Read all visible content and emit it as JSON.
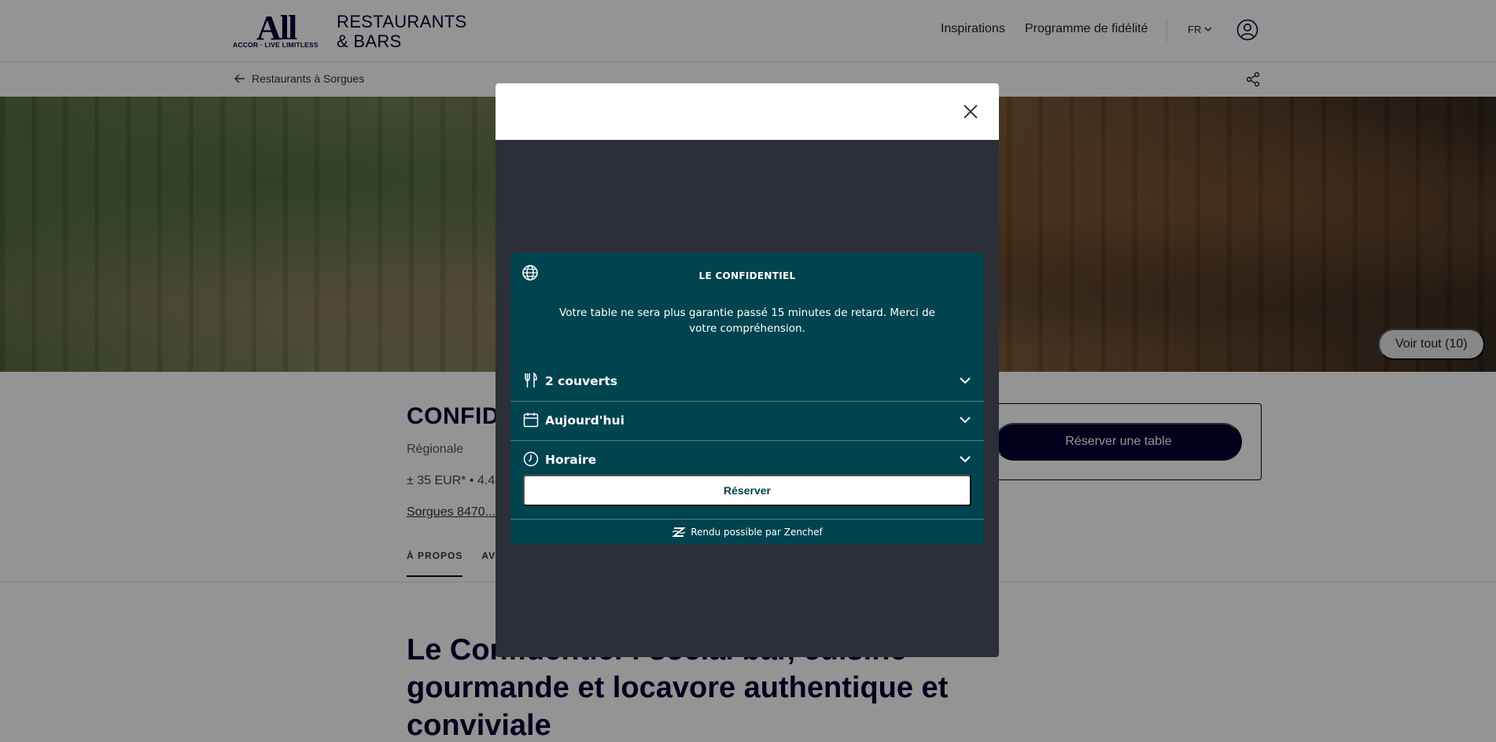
{
  "header": {
    "logo_text": "All",
    "logo_tagline": "ACCOR · LIVE LIMITLESS",
    "brand_line1": "RESTAURANTS",
    "brand_line2": "& BARS",
    "nav_inspirations": "Inspirations",
    "nav_fidelite": "Programme de fidélité",
    "language": "FR"
  },
  "subnav": {
    "back_label": "Restaurants à Sorgues"
  },
  "hero": {
    "see_all_label": "Voir tout (10)"
  },
  "restaurant": {
    "name": "CONFID",
    "category": "Régionale",
    "price_rating": "± 35 EUR*  •  4.4",
    "address": "Sorgues 8470...",
    "tabs": [
      "À PROPOS",
      "AVI"
    ],
    "book_label": "Réserver une table",
    "headline": "Le Confidentiel : social bar, cuisine gourmande et locavore authentique et conviviale"
  },
  "modal": {
    "widget": {
      "title": "LE CONFIDENTIEL",
      "notice": "Votre table ne sera plus garantie passé 15 minutes de retard. Merci de votre compréhension.",
      "rows": [
        {
          "label": "2 couverts",
          "icon": "cutlery-icon"
        },
        {
          "label": "Aujourd'hui",
          "icon": "calendar-icon"
        },
        {
          "label": "Horaire",
          "icon": "clock-icon"
        }
      ],
      "submit_label": "Réserver",
      "footer": "Rendu possible par Zenchef"
    }
  },
  "colors": {
    "brand_navy": "#050033",
    "widget_teal": "#004450",
    "modal_bg": "#2b2f38"
  }
}
